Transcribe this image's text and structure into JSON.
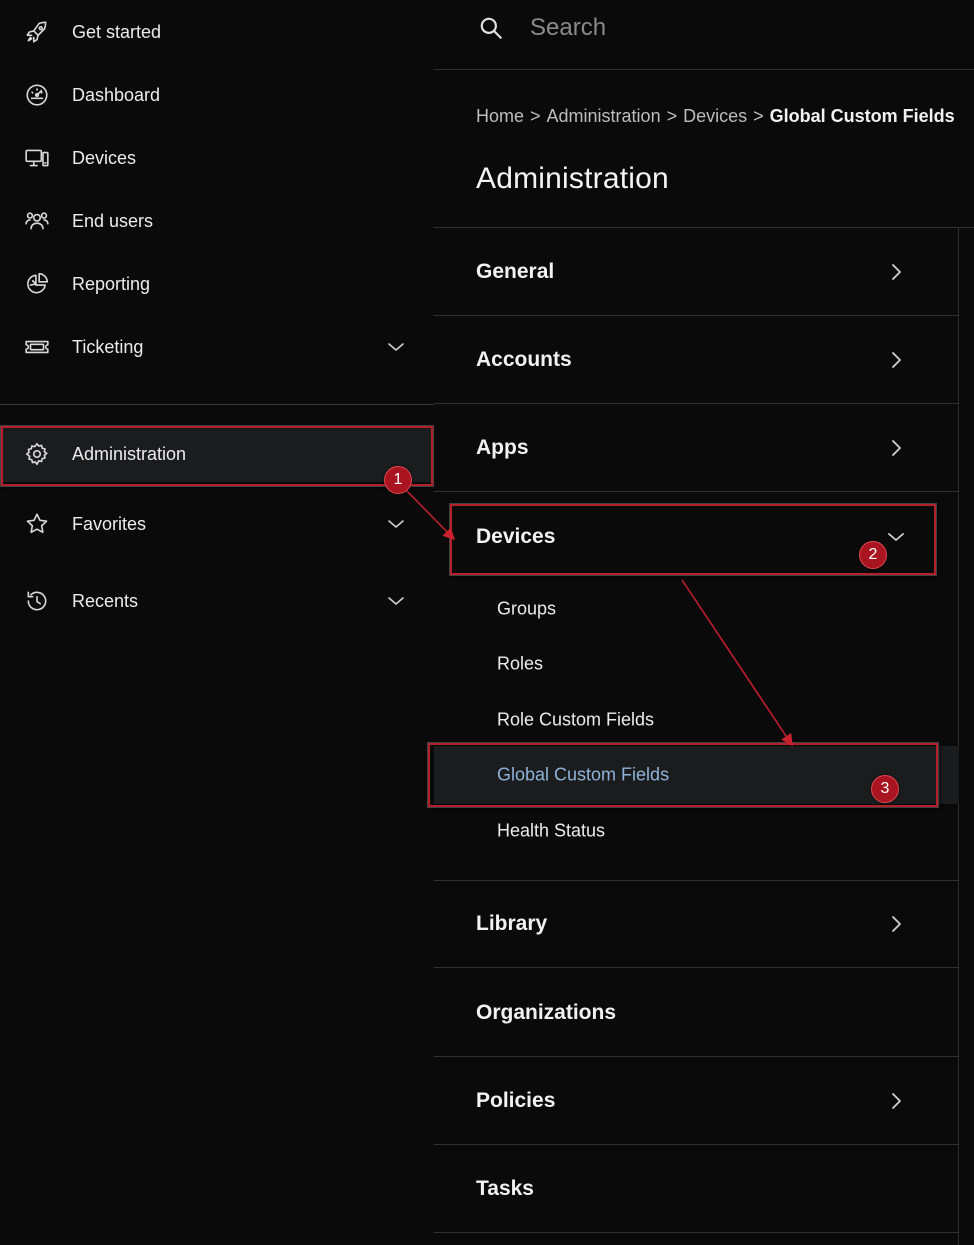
{
  "sidebar": {
    "items": [
      {
        "label": "Get started",
        "icon": "rocket-icon"
      },
      {
        "label": "Dashboard",
        "icon": "gauge-icon"
      },
      {
        "label": "Devices",
        "icon": "devices-icon"
      },
      {
        "label": "End users",
        "icon": "users-icon"
      },
      {
        "label": "Reporting",
        "icon": "pie-chart-icon"
      },
      {
        "label": "Ticketing",
        "icon": "ticket-icon",
        "expandable": true
      }
    ],
    "admin": {
      "label": "Administration",
      "icon": "gear-icon",
      "selected": true
    },
    "favorites": {
      "label": "Favorites",
      "icon": "star-icon",
      "expandable": true
    },
    "recents": {
      "label": "Recents",
      "icon": "history-icon",
      "expandable": true
    }
  },
  "search": {
    "placeholder": "Search",
    "icon": "search-icon"
  },
  "breadcrumb": {
    "items": [
      "Home",
      "Administration",
      "Devices",
      "Global Custom Fields"
    ],
    "separator": ">"
  },
  "page": {
    "title": "Administration"
  },
  "sections": {
    "general": "General",
    "accounts": "Accounts",
    "apps": "Apps",
    "devices": "Devices",
    "library": "Library",
    "organizations": "Organizations",
    "policies": "Policies",
    "tasks": "Tasks"
  },
  "devices_submenu": {
    "items": [
      "Groups",
      "Roles",
      "Role Custom Fields",
      "Global Custom Fields",
      "Health Status"
    ],
    "active": "Global Custom Fields"
  },
  "annotations": {
    "badge1": "1",
    "badge2": "2",
    "badge3": "3"
  },
  "colors": {
    "background": "#0a0a0a",
    "selected_row": "#1b1c1e",
    "active_link": "#8fb2d8",
    "annotation_red": "#b3202b"
  }
}
